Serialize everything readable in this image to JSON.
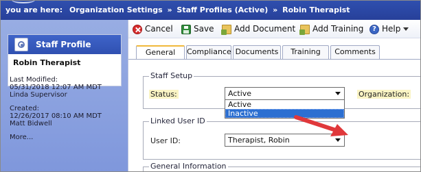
{
  "breadcrumb": {
    "items": [
      "you are here:",
      "Organization Settings",
      "Staff Profiles (Active)",
      "Robin Therapist"
    ],
    "separator": "»"
  },
  "sidebar": {
    "card_title": "Staff Profile",
    "name": "Robin Therapist",
    "last_modified_label": "Last Modified:",
    "last_modified_date": "05/31/2018 12:07 AM MDT",
    "last_modified_by": "Linda Supervisor",
    "created_label": "Created:",
    "created_date": "12/26/2017 08:10 AM MDT",
    "created_by": "Matt Bidwell",
    "more_link": "More..."
  },
  "toolbar": {
    "cancel": "Cancel",
    "save": "Save",
    "add_document": "Add Document",
    "add_training": "Add Training",
    "help": "Help"
  },
  "tabs": [
    "General",
    "Compliance",
    "Documents",
    "Training",
    "Comments"
  ],
  "active_tab": "General",
  "staff_setup": {
    "legend": "Staff Setup",
    "status_label": "Status:",
    "status_value": "Active",
    "status_options": [
      "Active",
      "Inactive"
    ],
    "highlighted_option": "Inactive",
    "organization_label": "Organization:"
  },
  "linked_user": {
    "legend": "Linked User ID",
    "user_id_label": "User ID:",
    "user_id_value": "Therapist, Robin"
  },
  "general_info": {
    "legend": "General Information"
  },
  "colors": {
    "breadcrumb_bg": "#2f4fae",
    "sidebar_bg": "#8ba2df",
    "card_header_bg": "#3f64c9",
    "active_tab_accent": "#f1b83a",
    "highlight_option": "#2c6fd1",
    "annotation_arrow": "#e0383b"
  },
  "icons": {
    "cancel": "cancel-icon",
    "save": "save-icon",
    "add_document": "add-document-icon",
    "add_training": "add-training-icon",
    "help": "help-icon",
    "profile": "staff-profile-icon"
  }
}
